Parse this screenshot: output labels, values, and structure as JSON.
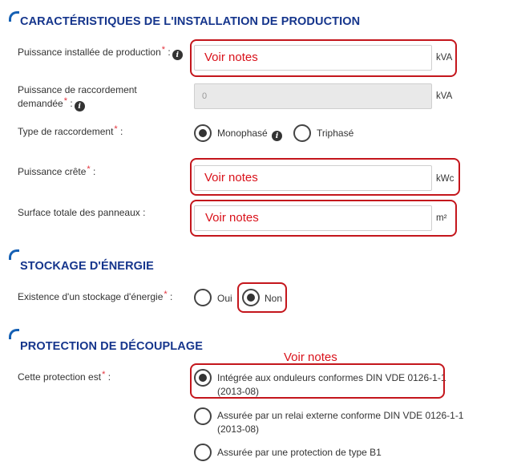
{
  "sections": {
    "installation": {
      "title": "CARACTÉRISTIQUES DE L'INSTALLATION DE PRODUCTION"
    },
    "stockage": {
      "title": "STOCKAGE D'ÉNERGIE"
    },
    "protection": {
      "title": "PROTECTION DE DÉCOUPLAGE"
    }
  },
  "fields": {
    "puissance_installee": {
      "label": "Puissance installée de production",
      "required": "*",
      "colon": ":",
      "value": "Voir notes",
      "unit": "kVA"
    },
    "puissance_raccordement": {
      "label_line1": "Puissance de raccordement",
      "label_line2": "demandée",
      "required": "*",
      "colon": ":",
      "value": "0",
      "unit": "kVA"
    },
    "type_raccordement": {
      "label": "Type de raccordement",
      "required": "*",
      "colon": ":",
      "options": [
        "Monophasé",
        "Triphasé"
      ],
      "selected": "Monophasé"
    },
    "puissance_crete": {
      "label": "Puissance crête",
      "required": "*",
      "colon": ":",
      "value": "Voir notes",
      "unit": "kWc"
    },
    "surface_panneaux": {
      "label": "Surface totale des panneaux :",
      "value": "Voir notes",
      "unit": "m²"
    },
    "stockage_existence": {
      "label": "Existence d'un stockage d'énergie",
      "required": "*",
      "colon": ":",
      "options": [
        "Oui",
        "Non"
      ],
      "selected": "Non"
    },
    "protection": {
      "label": "Cette protection est",
      "required": "*",
      "colon": ":",
      "annotation": "Voir notes",
      "options": [
        {
          "line1": "Intégrée aux onduleurs conformes DIN VDE 0126-1-1",
          "line2": "(2013-08)"
        },
        {
          "line1": "Assurée par un relai externe conforme DIN VDE 0126-1-1",
          "line2": "(2013-08)"
        },
        {
          "line1": "Assurée par une protection de type B1"
        }
      ],
      "selected_index": 0
    }
  },
  "icons": {
    "info": "info-icon",
    "section_marker": "corner-bracket-icon"
  },
  "colors": {
    "section_title": "#15358c",
    "accent": "#1560b4",
    "required": "#e3323c",
    "annotation": "#d9111a"
  }
}
